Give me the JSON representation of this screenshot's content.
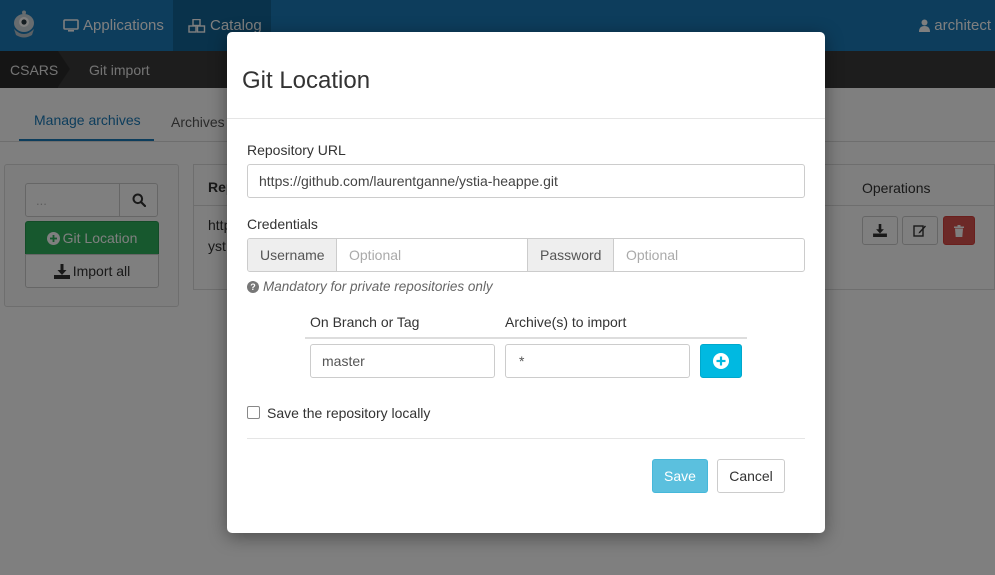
{
  "navbar": {
    "applications_label": "Applications",
    "catalog_label": "Catalog",
    "user_label": "architect"
  },
  "breadcrumb": {
    "root": "CSARS",
    "current": "Git import"
  },
  "tabs": [
    {
      "label": "Manage archives",
      "active": true
    },
    {
      "label": "Archives",
      "active": false
    }
  ],
  "left_panel": {
    "search_placeholder": "...",
    "git_location_label": "Git Location",
    "import_all_label": "Import all"
  },
  "table": {
    "repo_header": "Rep",
    "operations_header": "Operations",
    "row_line1": "http",
    "row_line2": "yst"
  },
  "modal": {
    "title": "Git Location",
    "repo_url_label": "Repository URL",
    "repo_url_value": "https://github.com/laurentganne/ystia-heappe.git",
    "credentials_label": "Credentials",
    "username_addon": "Username",
    "username_placeholder": "Optional",
    "password_addon": "Password",
    "password_placeholder": "Optional",
    "hint": "Mandatory for private repositories only",
    "branch_header": "On Branch or Tag",
    "archives_header": "Archive(s) to import",
    "branch_value": "master",
    "archives_value": "*",
    "save_local_label": "Save the repository locally",
    "save_local_checked": false,
    "save_label": "Save",
    "cancel_label": "Cancel"
  },
  "colors": {
    "navbar": "#1a7ab8",
    "catalog_active": "#126597",
    "success": "#2eb15d",
    "danger": "#d9534f",
    "info": "#5bc0de",
    "add": "#00b9e1"
  }
}
